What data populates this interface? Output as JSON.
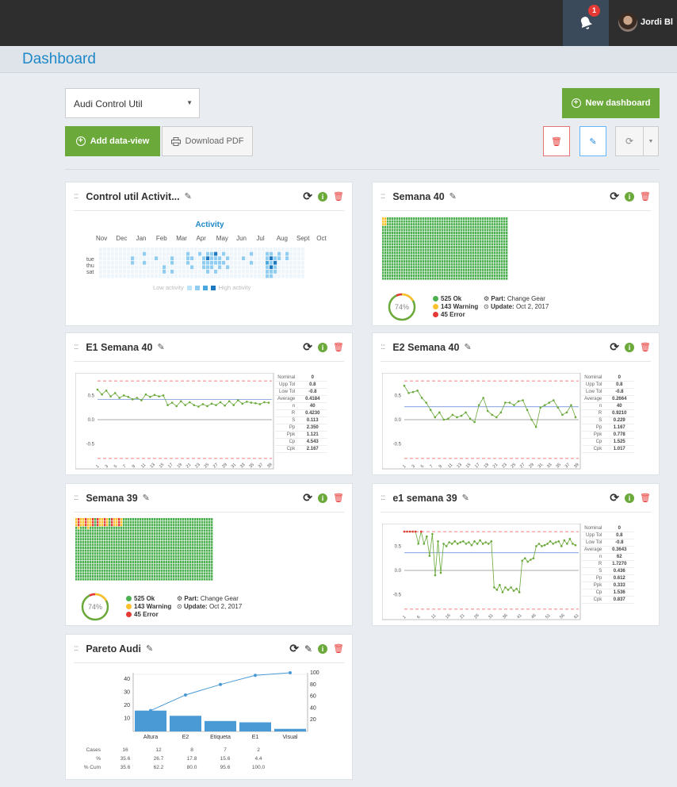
{
  "topbar": {
    "notifications": "1",
    "user_name": "Jordi Bl"
  },
  "page": {
    "title": "Dashboard"
  },
  "toolbar": {
    "dashboard_select": "Audi Control Util",
    "new_dashboard": "New dashboard",
    "add_view": "Add data-view",
    "download_pdf": "Download PDF"
  },
  "colors": {
    "accent": "#1e88c8",
    "green": "#6aa93a",
    "ok": "#4caf50",
    "warning": "#fbc02d",
    "error": "#e53935"
  },
  "cards": [
    {
      "title": "Control util Activit...",
      "type": "heatmap"
    },
    {
      "title": "Semana 40",
      "type": "status-grid"
    },
    {
      "title": "E1 Semana 40",
      "type": "control-chart"
    },
    {
      "title": "E2 Semana 40",
      "type": "control-chart"
    },
    {
      "title": "Semana 39",
      "type": "status-grid"
    },
    {
      "title": "e1 semana 39",
      "type": "control-chart"
    },
    {
      "title": "Pareto Audi",
      "type": "pareto"
    }
  ],
  "heatmap": {
    "title": "Activity",
    "months": [
      "Nov",
      "Dec",
      "Jan",
      "Feb",
      "Mar",
      "Apr",
      "May",
      "Jun",
      "Jul",
      "Aug",
      "Sept",
      "Oct"
    ],
    "days": [
      "tue",
      "thu",
      "sat"
    ],
    "low": "Low activity",
    "high": "High activity"
  },
  "status": {
    "percent": "74%",
    "ok_label": "525 Ok",
    "warn_label": "143 Warning",
    "err_label": "45 Error",
    "part_label": "Part:",
    "part_value": "Change Gear",
    "update_label": "Update:",
    "update_value": "Oct 2, 2017"
  },
  "stats_labels": [
    "Nominal",
    "Upp Tol",
    "Low Tol",
    "Average",
    "n",
    "R",
    "S",
    "Pp",
    "Ppk",
    "Cp",
    "Cpk"
  ],
  "stats_e1_40": [
    "0",
    "0.8",
    "-0.8",
    "0.4184",
    "40",
    "0.4230",
    "0.113",
    "2.350",
    "1.121",
    "4.543",
    "2.167"
  ],
  "stats_e2_40": [
    "0",
    "0.8",
    "-0.8",
    "0.2664",
    "40",
    "0.9210",
    "0.229",
    "1.167",
    "0.778",
    "1.525",
    "1.017"
  ],
  "stats_e1_39": [
    "0",
    "0.8",
    "-0.8",
    "0.3643",
    "62",
    "1.7270",
    "0.436",
    "0.612",
    "0.333",
    "1.536",
    "0.837"
  ],
  "chart_data": [
    {
      "type": "line",
      "title": "E1 Semana 40",
      "y_ticks": [
        "0.5",
        "0.0",
        "-0.5"
      ],
      "x_ticks": [
        "1",
        "3",
        "5",
        "7",
        "9",
        "11",
        "13",
        "15",
        "17",
        "19",
        "21",
        "23",
        "25",
        "27",
        "29",
        "31",
        "33",
        "35",
        "37",
        "39"
      ],
      "ylim": [
        -0.9,
        0.9
      ],
      "limits": [
        0.8,
        -0.8
      ],
      "average": 0.4184,
      "values": [
        0.62,
        0.52,
        0.6,
        0.48,
        0.55,
        0.45,
        0.5,
        0.47,
        0.42,
        0.45,
        0.4,
        0.52,
        0.47,
        0.51,
        0.48,
        0.5,
        0.3,
        0.35,
        0.28,
        0.38,
        0.3,
        0.36,
        0.3,
        0.27,
        0.32,
        0.28,
        0.33,
        0.3,
        0.36,
        0.29,
        0.38,
        0.3,
        0.4,
        0.33,
        0.37,
        0.35,
        0.34,
        0.32,
        0.36,
        0.35
      ]
    },
    {
      "type": "line",
      "title": "E2 Semana 40",
      "y_ticks": [
        "0.5",
        "0.0",
        "-0.5"
      ],
      "x_ticks": [
        "1",
        "3",
        "5",
        "7",
        "9",
        "11",
        "13",
        "15",
        "17",
        "19",
        "21",
        "23",
        "25",
        "27",
        "29",
        "31",
        "33",
        "35",
        "37",
        "39"
      ],
      "ylim": [
        -0.9,
        0.9
      ],
      "limits": [
        0.8,
        -0.8
      ],
      "average": 0.2664,
      "values": [
        0.7,
        0.55,
        0.57,
        0.6,
        0.45,
        0.35,
        0.2,
        0.05,
        0.15,
        0.0,
        0.02,
        0.1,
        0.05,
        0.08,
        0.15,
        0.02,
        -0.05,
        0.3,
        0.45,
        0.18,
        0.1,
        0.05,
        0.15,
        0.35,
        0.35,
        0.3,
        0.38,
        0.4,
        0.2,
        0.0,
        -0.15,
        0.25,
        0.3,
        0.35,
        0.4,
        0.25,
        0.1,
        0.15,
        0.3,
        0.05
      ]
    },
    {
      "type": "line",
      "title": "e1 semana 39",
      "y_ticks": [
        "0.5",
        "0.0",
        "-0.5"
      ],
      "x_ticks": [
        "1",
        "6",
        "11",
        "16",
        "21",
        "26",
        "31",
        "36",
        "41",
        "46",
        "51",
        "56",
        "61"
      ],
      "ylim": [
        -0.9,
        0.9
      ],
      "limits": [
        0.8,
        -0.8
      ],
      "average": 0.3643,
      "values": [
        0.8,
        0.8,
        0.8,
        0.8,
        0.8,
        0.55,
        0.8,
        0.55,
        0.7,
        0.3,
        0.75,
        -0.1,
        0.6,
        -0.05,
        0.55,
        0.5,
        0.58,
        0.55,
        0.6,
        0.55,
        0.58,
        0.6,
        0.55,
        0.58,
        0.52,
        0.6,
        0.55,
        0.62,
        0.55,
        0.58,
        0.55,
        0.6,
        -0.35,
        -0.4,
        -0.3,
        -0.45,
        -0.35,
        -0.4,
        -0.35,
        -0.42,
        -0.38,
        -0.45,
        0.2,
        0.25,
        0.18,
        0.22,
        0.25,
        0.5,
        0.55,
        0.5,
        0.52,
        0.55,
        0.6,
        0.55,
        0.58,
        0.6,
        0.5,
        0.62,
        0.55,
        0.65,
        0.55,
        0.52
      ]
    },
    {
      "type": "bar",
      "title": "Pareto Audi",
      "categories": [
        "Altura",
        "E2",
        "Etiqueta",
        "E1",
        "Visual"
      ],
      "values": [
        16,
        12,
        8,
        7,
        2
      ],
      "cum_pct": [
        35.6,
        62.2,
        80.0,
        95.6,
        100.0
      ],
      "y_ticks": [
        "40",
        "30",
        "20",
        "10"
      ],
      "y2_ticks": [
        "100",
        "80",
        "60",
        "40",
        "20"
      ],
      "ylim": [
        0,
        45
      ],
      "y2lim": [
        0,
        100
      ],
      "table": {
        "row_labels": [
          "Cases",
          "%",
          "% Cum"
        ],
        "cases": [
          "16",
          "12",
          "8",
          "7",
          "2"
        ],
        "pct": [
          "35.6",
          "26.7",
          "17.8",
          "15.6",
          "4.4"
        ],
        "cum": [
          "35.6",
          "62.2",
          "80.0",
          "95.6",
          "100.0"
        ]
      }
    }
  ]
}
